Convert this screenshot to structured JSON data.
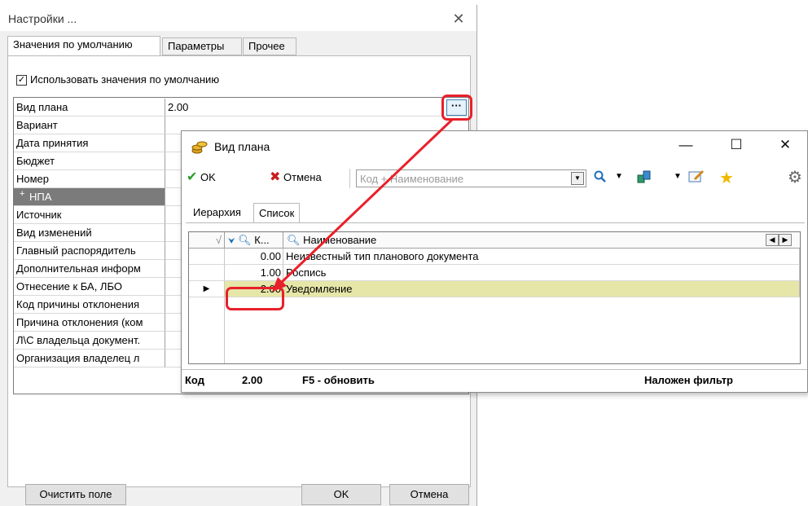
{
  "settings": {
    "title": "Настройки ...",
    "tabs": [
      "Значения по умолчанию",
      "Параметры",
      "Прочее"
    ],
    "use_defaults_label": "Использовать значения по умолчанию",
    "use_defaults_checked": true,
    "properties": [
      {
        "name": "Вид плана",
        "value": "2.00"
      },
      {
        "name": "Вариант",
        "value": ""
      },
      {
        "name": "Дата принятия",
        "value": ""
      },
      {
        "name": "Бюджет",
        "value": ""
      },
      {
        "name": "Номер",
        "value": ""
      },
      {
        "name": "НПА",
        "value": "",
        "group": true,
        "expander": "+"
      },
      {
        "name": "Источник",
        "value": ""
      },
      {
        "name": "Вид изменений",
        "value": ""
      },
      {
        "name": "Главный распорядитель",
        "value": ""
      },
      {
        "name": "Дополнительная информ",
        "value": ""
      },
      {
        "name": "Отнесение к БА, ЛБО",
        "value": ""
      },
      {
        "name": "Код причины отклонения",
        "value": ""
      },
      {
        "name": "Причина отклонения (ком",
        "value": ""
      },
      {
        "name": "Л\\С владельца документ.",
        "value": ""
      },
      {
        "name": "Организация владелец л",
        "value": ""
      }
    ],
    "ellipsis_label": "···",
    "buttons": {
      "clear": "Очистить поле",
      "ok": "OK",
      "cancel": "Отмена"
    }
  },
  "vid_plana": {
    "title": "Вид плана",
    "toolbar": {
      "ok": "OK",
      "cancel": "Отмена",
      "search_placeholder": "Код + Наименование"
    },
    "tabs": [
      "Иерархия",
      "Список"
    ],
    "columns": {
      "code": "К...",
      "name": "Наименование"
    },
    "rows": [
      {
        "code": "0.00",
        "name": "Неизвестный тип планового документа"
      },
      {
        "code": "1.00",
        "name": "Роспись"
      },
      {
        "code": "2.00",
        "name": "Уведомление",
        "selected": true
      }
    ],
    "status": {
      "label": "Код",
      "value": "2.00",
      "hint": "F5 - обновить",
      "filter": "Наложен фильтр"
    }
  },
  "colors": {
    "highlight": "#e8202b",
    "selected_row": "#e6e6a8",
    "group_row": "#7b7b7b"
  }
}
